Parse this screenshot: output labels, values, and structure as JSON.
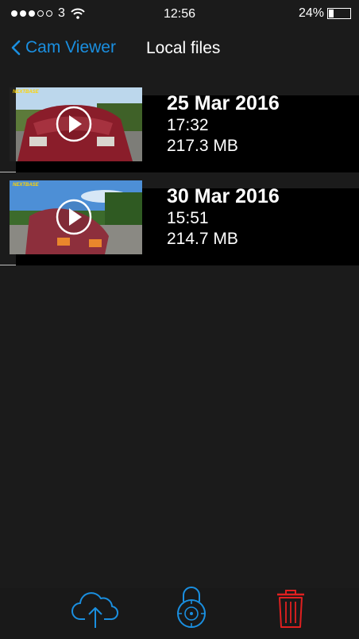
{
  "status": {
    "carrier": "3",
    "time": "12:56",
    "battery_text": "24%",
    "battery_level": 0.24,
    "signal_bars": 3
  },
  "nav": {
    "back_label": "Cam Viewer",
    "title": "Local files"
  },
  "files": [
    {
      "date": "25 Mar 2016",
      "time": "17:32",
      "size": "217.3 MB",
      "brand": "NEXTBASE"
    },
    {
      "date": "30 Mar 2016",
      "time": "15:51",
      "size": "214.7 MB",
      "brand": "NEXTBASE"
    }
  ],
  "toolbar": {
    "upload_icon": "cloud-upload-icon",
    "lock_icon": "padlock-icon",
    "delete_icon": "trash-icon"
  },
  "colors": {
    "accent": "#1a8fe0",
    "delete": "#e02020",
    "background": "#1b1b1b"
  }
}
